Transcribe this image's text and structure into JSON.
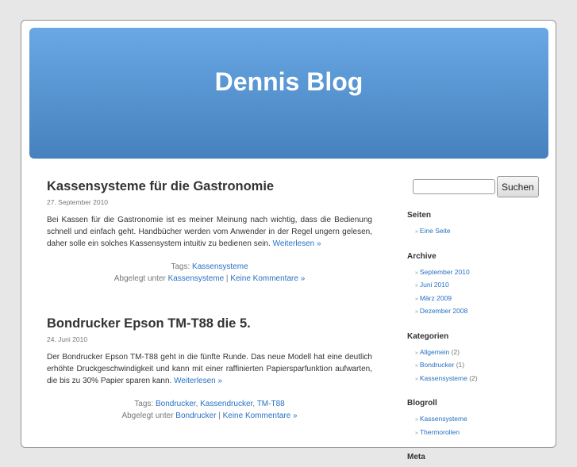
{
  "blog_title": "Dennis Blog",
  "posts": [
    {
      "title": "Kassensysteme für die Gastronomie",
      "date": "27. September 2010",
      "text": "Bei Kassen für die Gastronomie ist es meiner Meinung nach wichtig, dass die Bedienung schnell und einfach geht. Handbücher werden vom Anwender in der Regel ungern gelesen, daher solle ein solches Kassensystem intuitiv zu bedienen sein.",
      "more": "Weiterlesen »",
      "tags_label": "Tags:",
      "tags": [
        "Kassensysteme"
      ],
      "filed_label": "Abgelegt unter",
      "category": "Kassensysteme",
      "comments": "Keine Kommentare »"
    },
    {
      "title": "Bondrucker Epson TM-T88 die 5.",
      "date": "24. Juni 2010",
      "text": "Der Bondrucker Epson TM-T88 geht in die fünfte Runde. Das neue Modell hat eine deutlich erhöhte Druckgeschwindigkeit und kann mit einer raffinierten Papiersparfunktion aufwarten, die bis zu 30% Papier sparen kann.",
      "more": "Weiterlesen »",
      "tags_label": "Tags:",
      "tags": [
        "Bondrucker",
        "Kassendrucker",
        "TM-T88"
      ],
      "filed_label": "Abgelegt unter",
      "category": "Bondrucker",
      "comments": "Keine Kommentare »"
    }
  ],
  "sidebar": {
    "search_button": "Suchen",
    "search_value": "",
    "pages": {
      "title": "Seiten",
      "items": [
        "Eine Seite"
      ]
    },
    "archive": {
      "title": "Archive",
      "items": [
        "September 2010",
        "Juni 2010",
        "März 2009",
        "Dezember 2008"
      ]
    },
    "categories": {
      "title": "Kategorien",
      "items": [
        {
          "label": "Allgemein",
          "count": "(2)"
        },
        {
          "label": "Bondrucker",
          "count": "(1)"
        },
        {
          "label": "Kassensysteme",
          "count": "(2)"
        }
      ]
    },
    "blogroll": {
      "title": "Blogroll",
      "items": [
        "Kassensysteme",
        "Thermorollen"
      ]
    },
    "meta": {
      "title": "Meta"
    }
  }
}
